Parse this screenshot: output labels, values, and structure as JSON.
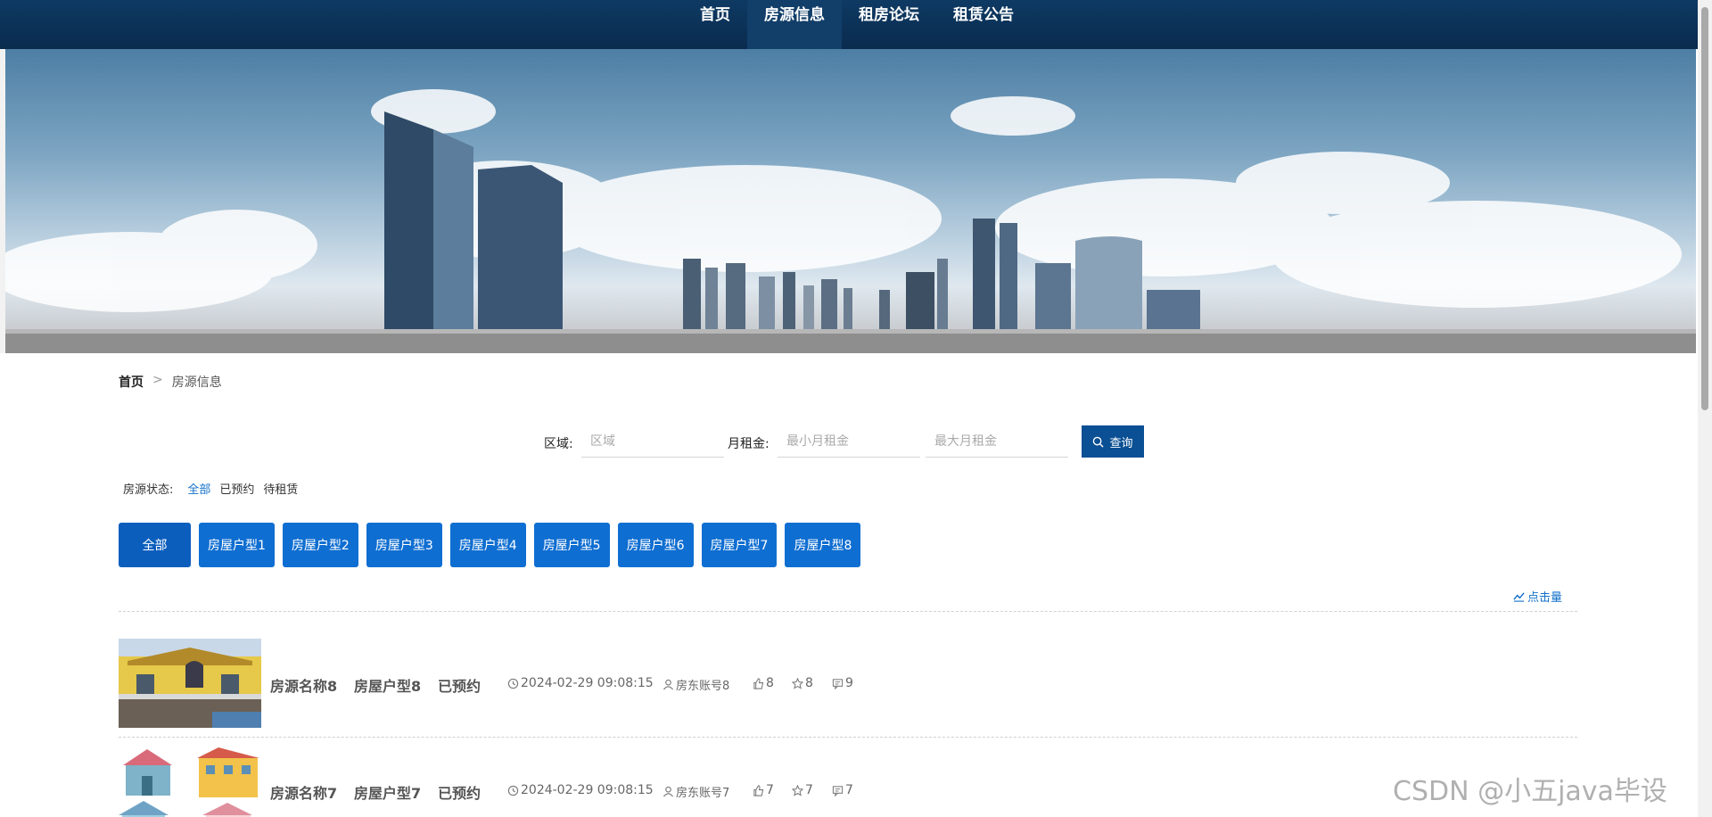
{
  "nav": {
    "items": [
      {
        "label": "首页"
      },
      {
        "label": "房源信息"
      },
      {
        "label": "租房论坛"
      },
      {
        "label": "租赁公告"
      }
    ],
    "active_index": 1
  },
  "breadcrumb": {
    "home": "首页",
    "separator": ">",
    "current": "房源信息"
  },
  "search": {
    "area_label": "区域:",
    "area_placeholder": "区域",
    "rent_label": "月租金:",
    "min_placeholder": "最小月租金",
    "max_placeholder": "最大月租金",
    "button_label": "查询"
  },
  "status_filter": {
    "label": "房源状态:",
    "options": [
      "全部",
      "已预约",
      "待租赁"
    ],
    "selected": "全部"
  },
  "types": [
    "全部",
    "房屋户型1",
    "房屋户型2",
    "房屋户型3",
    "房屋户型4",
    "房屋户型5",
    "房屋户型6",
    "房屋户型7",
    "房屋户型8"
  ],
  "sort_label": "点击量",
  "listings": [
    {
      "name": "房源名称8",
      "type": "房屋户型8",
      "status": "已预约",
      "time": "2024-02-29 09:08:15",
      "owner": "房东账号8",
      "likes": "8",
      "favorites": "8",
      "comments": "9"
    },
    {
      "name": "房源名称7",
      "type": "房屋户型7",
      "status": "已预约",
      "time": "2024-02-29 09:08:15",
      "owner": "房东账号7",
      "likes": "7",
      "favorites": "7",
      "comments": "7"
    }
  ],
  "watermark": "CSDN @小五java毕设",
  "colors": {
    "nav_bg": "#0a2b4e",
    "primary": "#0f6ed1",
    "link": "#1170c9",
    "slider_dot": "#e9473c"
  }
}
